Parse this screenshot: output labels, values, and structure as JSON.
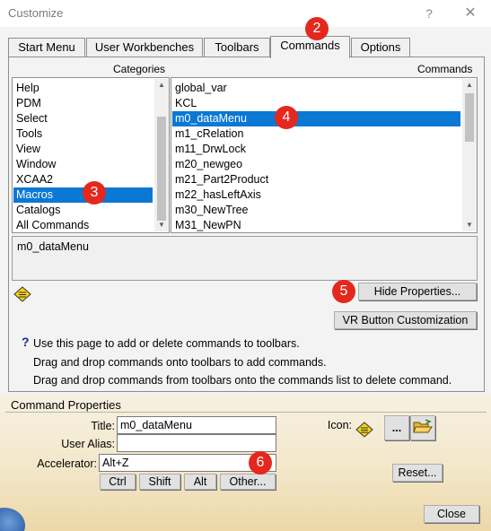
{
  "window": {
    "title": "Customize",
    "help_glyph": "?",
    "close_glyph": "✕"
  },
  "tabs": [
    {
      "label": "Start Menu",
      "active": false
    },
    {
      "label": "User Workbenches",
      "active": false
    },
    {
      "label": "Toolbars",
      "active": false
    },
    {
      "label": "Commands",
      "active": true
    },
    {
      "label": "Options",
      "active": false
    }
  ],
  "categories": {
    "header": "Categories",
    "items": [
      "Help",
      "PDM",
      "Select",
      "Tools",
      "View",
      "Window",
      "XCAA2",
      "Macros",
      "Catalogs",
      "All Commands"
    ],
    "selected": "Macros"
  },
  "commands": {
    "header": "Commands",
    "items": [
      "global_var",
      "KCL",
      "m0_dataMenu",
      "m1_cRelation",
      "m11_DrwLock",
      "m20_newgeo",
      "m21_Part2Product",
      "m22_hasLeftAxis",
      "m30_NewTree",
      "M31_NewPN"
    ],
    "selected": "m0_dataMenu"
  },
  "description": {
    "text": "m0_dataMenu"
  },
  "buttons": {
    "hide_properties": "Hide Properties...",
    "vr_customization": "VR Button Customization",
    "reset": "Reset...",
    "close": "Close",
    "icon_more": "...",
    "ctrl": "Ctrl",
    "shift": "Shift",
    "alt": "Alt",
    "other": "Other..."
  },
  "info": {
    "help_glyph": "?",
    "lines": [
      "Use this page to add or delete commands to toolbars.",
      "Drag and drop commands onto toolbars to add commands.",
      "Drag and drop commands from toolbars onto the commands list to delete command."
    ]
  },
  "command_properties": {
    "title": "Command Properties",
    "title_label": "Title:",
    "title_value": "m0_dataMenu",
    "user_alias_label": "User Alias:",
    "user_alias_value": "",
    "accelerator_label": "Accelerator:",
    "accelerator_value": "Alt+Z",
    "icon_label": "Icon:"
  },
  "markers": [
    "2",
    "3",
    "4",
    "5",
    "6"
  ],
  "colors": {
    "selection": "#0b78d4",
    "marker": "#e5281d",
    "icon_yellow": "#f2d21b"
  },
  "icons": [
    "help-icon",
    "close-icon",
    "diamond-macro-icon",
    "open-folder-icon"
  ]
}
